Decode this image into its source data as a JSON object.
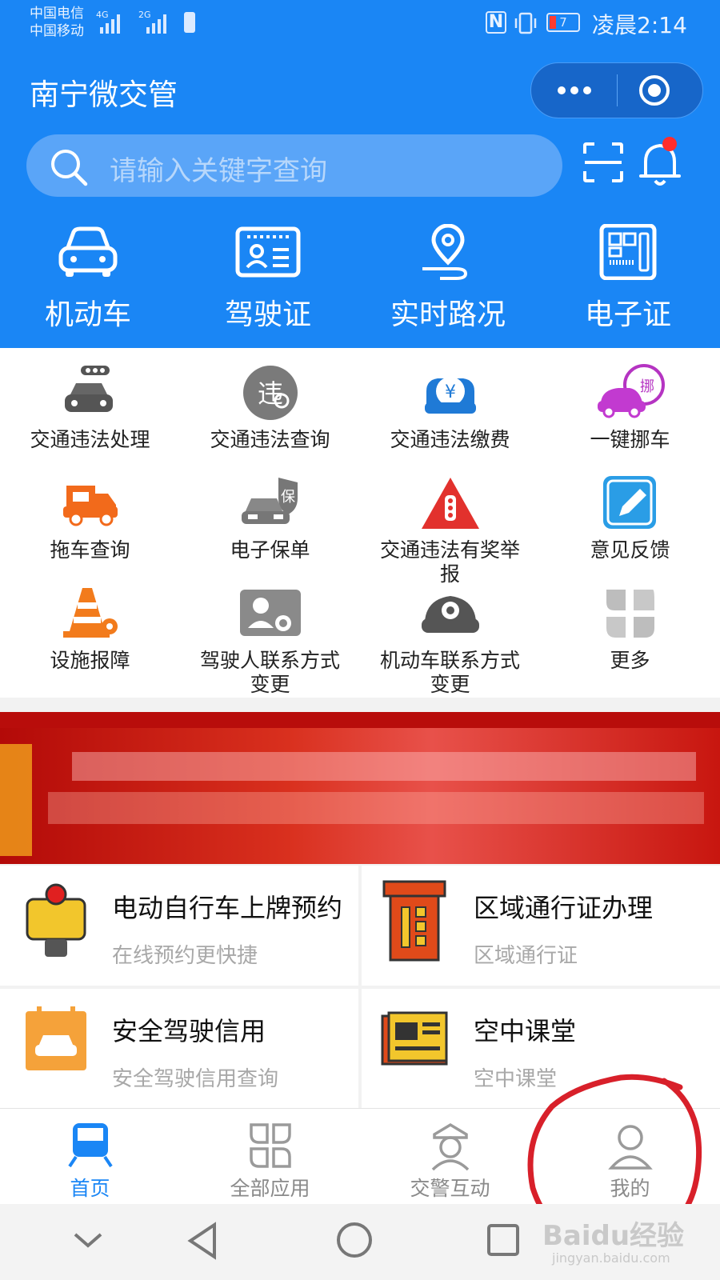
{
  "status_bar": {
    "carrier1": "中国电信",
    "carrier2": "中国移动",
    "net1": "4G",
    "net2": "2G",
    "battery": "7",
    "time": "凌晨2:14"
  },
  "header": {
    "title": "南宁微交管"
  },
  "search": {
    "placeholder": "请输入关键字查询"
  },
  "quick_actions": [
    {
      "label": "机动车",
      "icon": "car-icon"
    },
    {
      "label": "驾驶证",
      "icon": "license-icon"
    },
    {
      "label": "实时路况",
      "icon": "map-pin-icon"
    },
    {
      "label": "电子证",
      "icon": "e-cert-icon"
    }
  ],
  "services": [
    {
      "label": "交通违法处理",
      "icon": "car-traffic-light-icon"
    },
    {
      "label": "交通违法查询",
      "icon": "violation-search-icon"
    },
    {
      "label": "交通违法缴费",
      "icon": "yen-car-icon"
    },
    {
      "label": "一键挪车",
      "icon": "move-car-icon"
    },
    {
      "label": "拖车查询",
      "icon": "tow-truck-icon"
    },
    {
      "label": "电子保单",
      "icon": "insurance-car-icon"
    },
    {
      "label": "交通违法有奖举",
      "label2": "报",
      "icon": "report-triangle-icon"
    },
    {
      "label": "意见反馈",
      "icon": "feedback-pencil-icon"
    },
    {
      "label": "设施报障",
      "icon": "traffic-cone-icon"
    },
    {
      "label": "驾驶人联系方式",
      "label2": "变更",
      "icon": "driver-contact-icon"
    },
    {
      "label": "机动车联系方式",
      "label2": "变更",
      "icon": "vehicle-contact-icon"
    },
    {
      "label": "更多",
      "icon": "more-grid-icon"
    }
  ],
  "cards": [
    {
      "title": "电动自行车上牌预约",
      "subtitle": "在线预约更快捷",
      "icon": "e-bike-icon"
    },
    {
      "title": "区域通行证办理",
      "subtitle": "区域通行证",
      "icon": "area-pass-icon"
    },
    {
      "title": "安全驾驶信用",
      "subtitle": "安全驾驶信用查询",
      "icon": "calendar-car-icon"
    },
    {
      "title": "空中课堂",
      "subtitle": "空中课堂",
      "icon": "newspaper-icon"
    }
  ],
  "tabs": [
    {
      "label": "首页",
      "active": true,
      "icon": "train-icon"
    },
    {
      "label": "全部应用",
      "active": false,
      "icon": "apps-icon"
    },
    {
      "label": "交警互动",
      "active": false,
      "icon": "police-icon"
    },
    {
      "label": "我的",
      "active": false,
      "icon": "person-icon"
    }
  ],
  "watermark": {
    "text": "Baidu经验",
    "url": "jingyan.baidu.com"
  },
  "colors": {
    "primary": "#1a86f5",
    "annotation": "#d8202a"
  }
}
